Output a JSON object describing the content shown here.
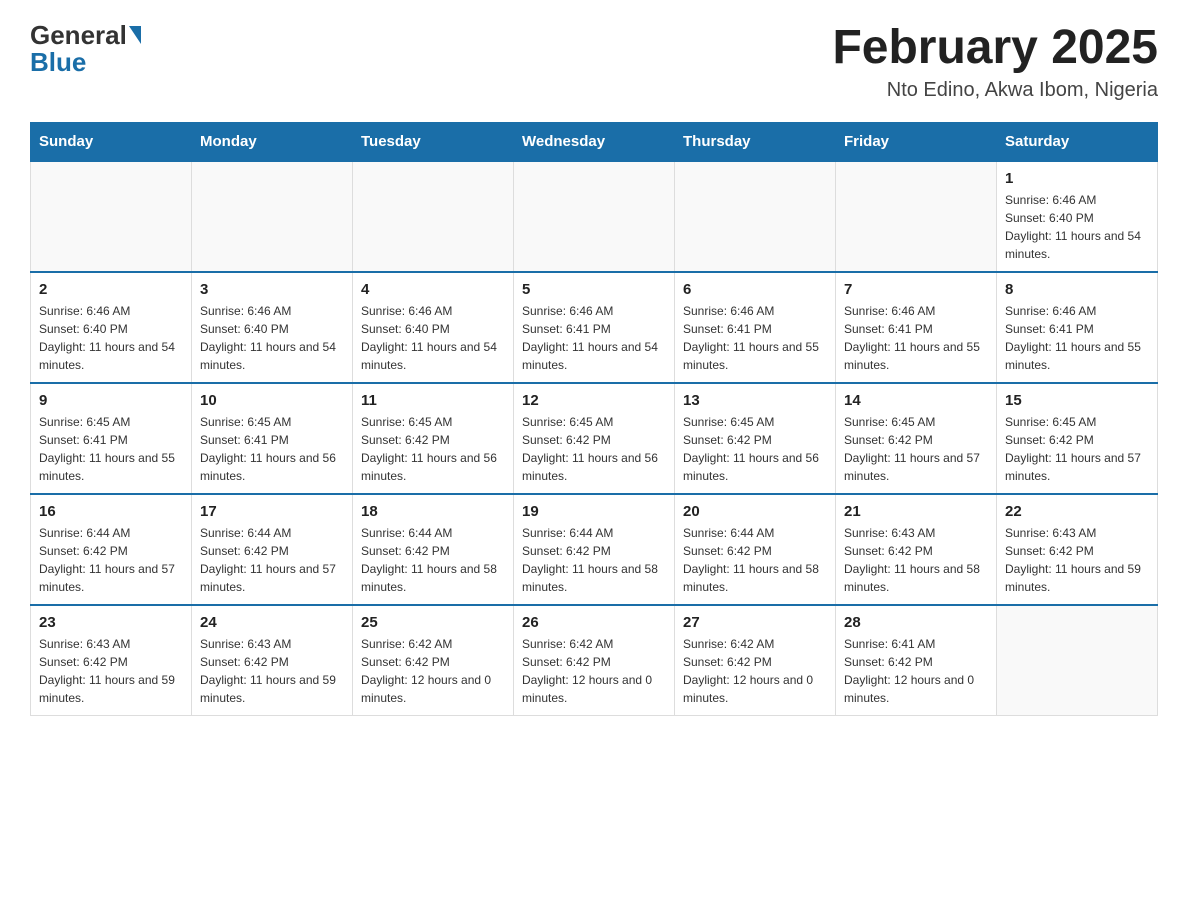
{
  "header": {
    "logo_general": "General",
    "logo_blue": "Blue",
    "month_title": "February 2025",
    "location": "Nto Edino, Akwa Ibom, Nigeria"
  },
  "days_of_week": [
    "Sunday",
    "Monday",
    "Tuesday",
    "Wednesday",
    "Thursday",
    "Friday",
    "Saturday"
  ],
  "weeks": [
    [
      {
        "day": "",
        "empty": true
      },
      {
        "day": "",
        "empty": true
      },
      {
        "day": "",
        "empty": true
      },
      {
        "day": "",
        "empty": true
      },
      {
        "day": "",
        "empty": true
      },
      {
        "day": "",
        "empty": true
      },
      {
        "day": "1",
        "sunrise": "6:46 AM",
        "sunset": "6:40 PM",
        "daylight": "11 hours and 54 minutes."
      }
    ],
    [
      {
        "day": "2",
        "sunrise": "6:46 AM",
        "sunset": "6:40 PM",
        "daylight": "11 hours and 54 minutes."
      },
      {
        "day": "3",
        "sunrise": "6:46 AM",
        "sunset": "6:40 PM",
        "daylight": "11 hours and 54 minutes."
      },
      {
        "day": "4",
        "sunrise": "6:46 AM",
        "sunset": "6:40 PM",
        "daylight": "11 hours and 54 minutes."
      },
      {
        "day": "5",
        "sunrise": "6:46 AM",
        "sunset": "6:41 PM",
        "daylight": "11 hours and 54 minutes."
      },
      {
        "day": "6",
        "sunrise": "6:46 AM",
        "sunset": "6:41 PM",
        "daylight": "11 hours and 55 minutes."
      },
      {
        "day": "7",
        "sunrise": "6:46 AM",
        "sunset": "6:41 PM",
        "daylight": "11 hours and 55 minutes."
      },
      {
        "day": "8",
        "sunrise": "6:46 AM",
        "sunset": "6:41 PM",
        "daylight": "11 hours and 55 minutes."
      }
    ],
    [
      {
        "day": "9",
        "sunrise": "6:45 AM",
        "sunset": "6:41 PM",
        "daylight": "11 hours and 55 minutes."
      },
      {
        "day": "10",
        "sunrise": "6:45 AM",
        "sunset": "6:41 PM",
        "daylight": "11 hours and 56 minutes."
      },
      {
        "day": "11",
        "sunrise": "6:45 AM",
        "sunset": "6:42 PM",
        "daylight": "11 hours and 56 minutes."
      },
      {
        "day": "12",
        "sunrise": "6:45 AM",
        "sunset": "6:42 PM",
        "daylight": "11 hours and 56 minutes."
      },
      {
        "day": "13",
        "sunrise": "6:45 AM",
        "sunset": "6:42 PM",
        "daylight": "11 hours and 56 minutes."
      },
      {
        "day": "14",
        "sunrise": "6:45 AM",
        "sunset": "6:42 PM",
        "daylight": "11 hours and 57 minutes."
      },
      {
        "day": "15",
        "sunrise": "6:45 AM",
        "sunset": "6:42 PM",
        "daylight": "11 hours and 57 minutes."
      }
    ],
    [
      {
        "day": "16",
        "sunrise": "6:44 AM",
        "sunset": "6:42 PM",
        "daylight": "11 hours and 57 minutes."
      },
      {
        "day": "17",
        "sunrise": "6:44 AM",
        "sunset": "6:42 PM",
        "daylight": "11 hours and 57 minutes."
      },
      {
        "day": "18",
        "sunrise": "6:44 AM",
        "sunset": "6:42 PM",
        "daylight": "11 hours and 58 minutes."
      },
      {
        "day": "19",
        "sunrise": "6:44 AM",
        "sunset": "6:42 PM",
        "daylight": "11 hours and 58 minutes."
      },
      {
        "day": "20",
        "sunrise": "6:44 AM",
        "sunset": "6:42 PM",
        "daylight": "11 hours and 58 minutes."
      },
      {
        "day": "21",
        "sunrise": "6:43 AM",
        "sunset": "6:42 PM",
        "daylight": "11 hours and 58 minutes."
      },
      {
        "day": "22",
        "sunrise": "6:43 AM",
        "sunset": "6:42 PM",
        "daylight": "11 hours and 59 minutes."
      }
    ],
    [
      {
        "day": "23",
        "sunrise": "6:43 AM",
        "sunset": "6:42 PM",
        "daylight": "11 hours and 59 minutes."
      },
      {
        "day": "24",
        "sunrise": "6:43 AM",
        "sunset": "6:42 PM",
        "daylight": "11 hours and 59 minutes."
      },
      {
        "day": "25",
        "sunrise": "6:42 AM",
        "sunset": "6:42 PM",
        "daylight": "12 hours and 0 minutes."
      },
      {
        "day": "26",
        "sunrise": "6:42 AM",
        "sunset": "6:42 PM",
        "daylight": "12 hours and 0 minutes."
      },
      {
        "day": "27",
        "sunrise": "6:42 AM",
        "sunset": "6:42 PM",
        "daylight": "12 hours and 0 minutes."
      },
      {
        "day": "28",
        "sunrise": "6:41 AM",
        "sunset": "6:42 PM",
        "daylight": "12 hours and 0 minutes."
      },
      {
        "day": "",
        "empty": true
      }
    ]
  ]
}
